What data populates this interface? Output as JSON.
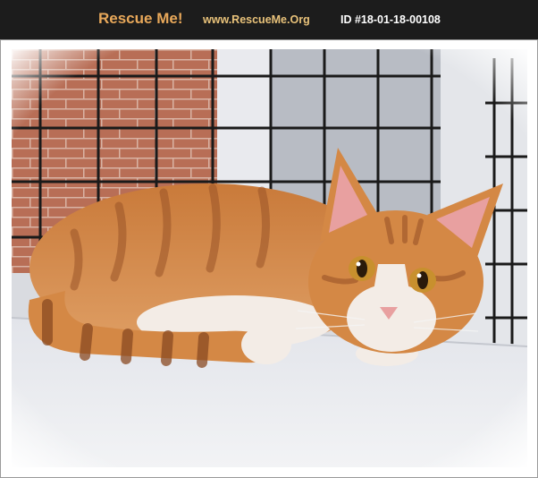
{
  "header": {
    "brand": "Rescue Me!",
    "site": "www.RescueMe.Org",
    "pet_id": "ID #18-01-18-00108"
  },
  "photo": {
    "subject": "orange tabby cat",
    "colors": {
      "brick": "#b86e56",
      "grid": "#1a1a1a",
      "shelf": "#e8eaee",
      "fur": "#d48845",
      "fur_dark": "#9a5428",
      "white_fur": "#f3ece6",
      "eye": "#c8902e",
      "nose": "#e8a0a0"
    }
  }
}
